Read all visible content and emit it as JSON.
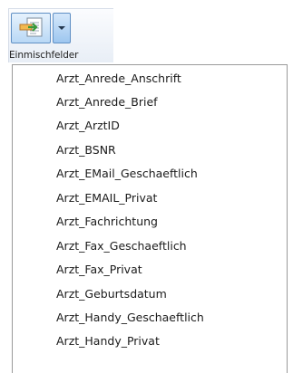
{
  "ribbon": {
    "group_label": "Einmischfelder",
    "insert_icon": "insert-fields-icon",
    "dropdown_icon": "chevron-down-icon"
  },
  "menu": {
    "items": [
      "Arzt_Anrede_Anschrift",
      "Arzt_Anrede_Brief",
      "Arzt_ArztID",
      "Arzt_BSNR",
      "Arzt_EMail_Geschaeftlich",
      "Arzt_EMAIL_Privat",
      "Arzt_Fachrichtung",
      "Arzt_Fax_Geschaeftlich",
      "Arzt_Fax_Privat",
      "Arzt_Geburtsdatum",
      "Arzt_Handy_Geschaeftlich",
      "Arzt_Handy_Privat"
    ]
  }
}
